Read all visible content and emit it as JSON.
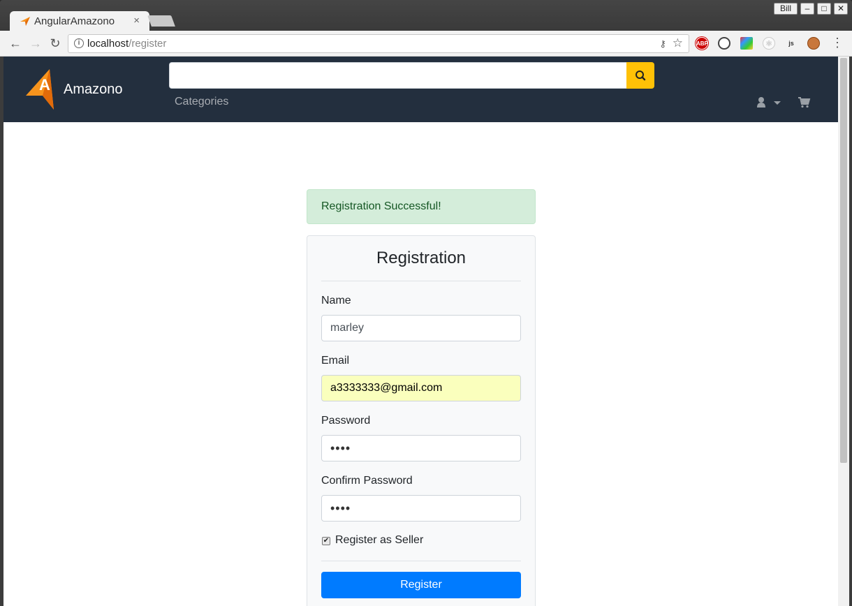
{
  "browser": {
    "tab_title": "AngularAmazono",
    "tab_close": "×",
    "user_name": "Bill",
    "minimize": "–",
    "maximize": "□",
    "close": "✕",
    "url_host": "localhost",
    "url_path": "/register",
    "info_icon": "i",
    "extensions": [
      "ABP",
      "sync",
      "colorzilla",
      "react",
      "js",
      "monkey"
    ]
  },
  "navbar": {
    "brand": "Amazono",
    "search_value": "",
    "categories": "Categories",
    "icons": [
      "search-icon",
      "user-icon",
      "caret-down-icon",
      "cart-icon"
    ]
  },
  "alert": {
    "message": "Registration Successful!",
    "color": "#155724"
  },
  "form": {
    "title": "Registration",
    "name_label": "Name",
    "name_value": "marley",
    "email_label": "Email",
    "email_value": "a3333333@gmail.com",
    "password_label": "Password",
    "password_value": "••••",
    "confirm_label": "Confirm Password",
    "confirm_value": "••••",
    "seller_label": "Register as Seller",
    "seller_checked": true,
    "submit_label": "Register",
    "accent_color": "#007bff"
  }
}
